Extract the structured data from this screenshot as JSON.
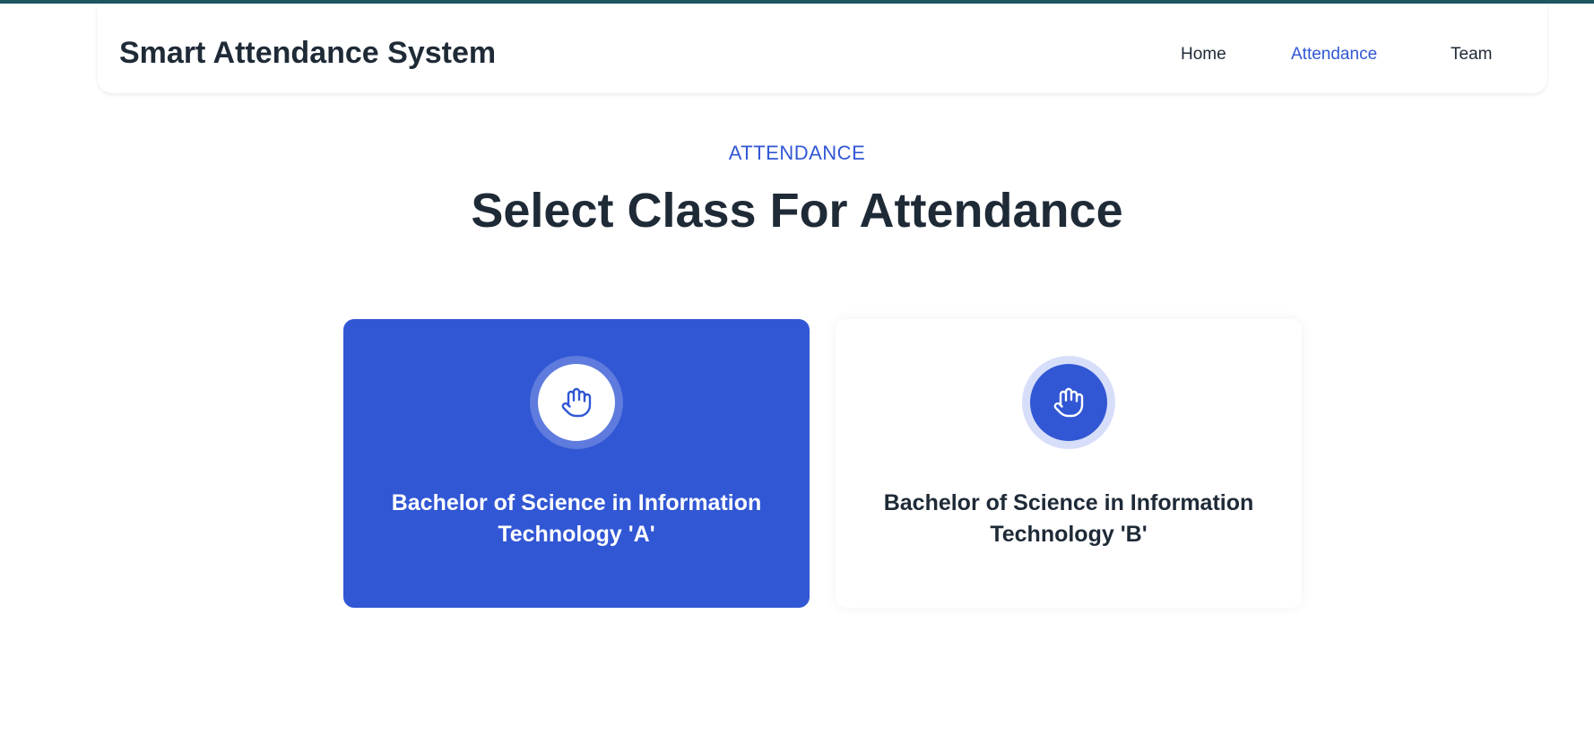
{
  "app": {
    "title": "Smart Attendance System"
  },
  "nav": {
    "items": [
      {
        "label": "Home",
        "active": false
      },
      {
        "label": "Attendance",
        "active": true
      },
      {
        "label": "Team",
        "active": false
      }
    ]
  },
  "main": {
    "eyebrow": "ATTENDANCE",
    "title": "Select Class For Attendance",
    "classes": [
      {
        "label": "Bachelor of Science in Information Technology 'A'",
        "icon": "hand-icon",
        "selected": true
      },
      {
        "label": "Bachelor of Science in Information Technology 'B'",
        "icon": "hand-icon",
        "selected": false
      }
    ]
  },
  "colors": {
    "accent": "#3157d4",
    "text": "#1f2a37",
    "topline": "#1d5560"
  }
}
